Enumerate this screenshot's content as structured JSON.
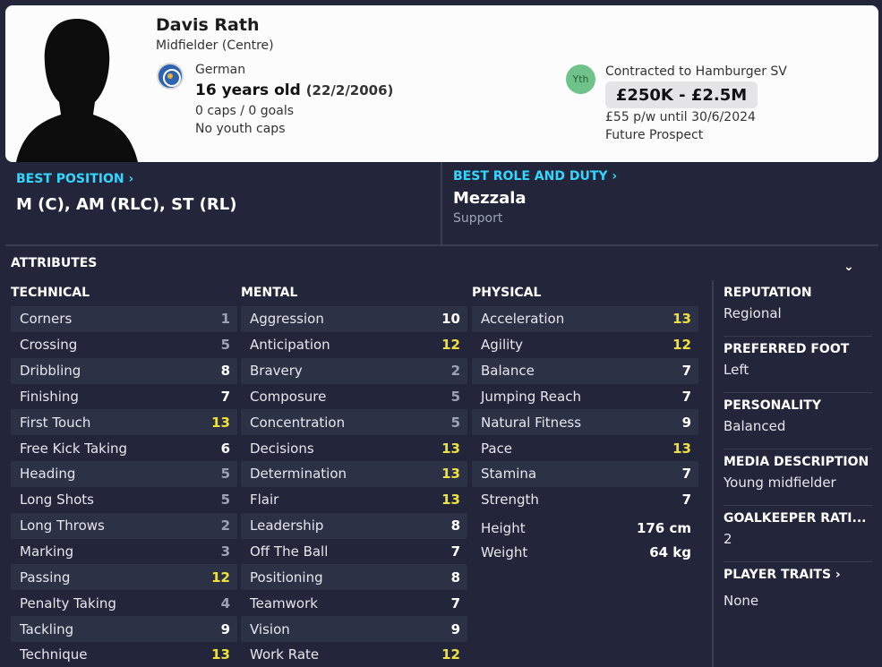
{
  "player": {
    "name": "Davis Rath",
    "position": "Midfielder (Centre)",
    "nationality": "German",
    "age": "16 years old",
    "dob": "(22/2/2006)",
    "caps": "0 caps / 0 goals",
    "youth_caps": "No youth caps"
  },
  "contract": {
    "badge": "Yth",
    "club": "Contracted to Hamburger SV",
    "value": "£250K - £2.5M",
    "wage": "£55 p/w until 30/6/2024",
    "status": "Future Prospect"
  },
  "best_position": {
    "label": "BEST POSITION",
    "value": "M (C), AM (RLC), ST (RL)"
  },
  "best_role": {
    "label": "BEST ROLE AND DUTY",
    "role": "Mezzala",
    "duty": "Support"
  },
  "attributes_title": "ATTRIBUTES",
  "columns": {
    "technical": {
      "title": "TECHNICAL",
      "rows": [
        {
          "name": "Corners",
          "value": "1"
        },
        {
          "name": "Crossing",
          "value": "5"
        },
        {
          "name": "Dribbling",
          "value": "8"
        },
        {
          "name": "Finishing",
          "value": "7"
        },
        {
          "name": "First Touch",
          "value": "13"
        },
        {
          "name": "Free Kick Taking",
          "value": "6"
        },
        {
          "name": "Heading",
          "value": "5"
        },
        {
          "name": "Long Shots",
          "value": "5"
        },
        {
          "name": "Long Throws",
          "value": "2"
        },
        {
          "name": "Marking",
          "value": "3"
        },
        {
          "name": "Passing",
          "value": "12"
        },
        {
          "name": "Penalty Taking",
          "value": "4"
        },
        {
          "name": "Tackling",
          "value": "9"
        },
        {
          "name": "Technique",
          "value": "13"
        }
      ]
    },
    "mental": {
      "title": "MENTAL",
      "rows": [
        {
          "name": "Aggression",
          "value": "10"
        },
        {
          "name": "Anticipation",
          "value": "12"
        },
        {
          "name": "Bravery",
          "value": "2"
        },
        {
          "name": "Composure",
          "value": "5"
        },
        {
          "name": "Concentration",
          "value": "5"
        },
        {
          "name": "Decisions",
          "value": "13"
        },
        {
          "name": "Determination",
          "value": "13"
        },
        {
          "name": "Flair",
          "value": "13"
        },
        {
          "name": "Leadership",
          "value": "8"
        },
        {
          "name": "Off The Ball",
          "value": "7"
        },
        {
          "name": "Positioning",
          "value": "8"
        },
        {
          "name": "Teamwork",
          "value": "7"
        },
        {
          "name": "Vision",
          "value": "9"
        },
        {
          "name": "Work Rate",
          "value": "12"
        }
      ]
    },
    "physical": {
      "title": "PHYSICAL",
      "rows": [
        {
          "name": "Acceleration",
          "value": "13"
        },
        {
          "name": "Agility",
          "value": "12"
        },
        {
          "name": "Balance",
          "value": "7"
        },
        {
          "name": "Jumping Reach",
          "value": "7"
        },
        {
          "name": "Natural Fitness",
          "value": "9"
        },
        {
          "name": "Pace",
          "value": "13"
        },
        {
          "name": "Stamina",
          "value": "7"
        },
        {
          "name": "Strength",
          "value": "7"
        }
      ],
      "height_label": "Height",
      "height": "176 cm",
      "weight_label": "Weight",
      "weight": "64 kg"
    }
  },
  "side": [
    {
      "heading": "REPUTATION",
      "value": "Regional"
    },
    {
      "heading": "PREFERRED FOOT",
      "value": "Left"
    },
    {
      "heading": "PERSONALITY",
      "value": "Balanced"
    },
    {
      "heading": "MEDIA DESCRIPTION",
      "value": "Young midfielder"
    },
    {
      "heading": "GOALKEEPER RATI...",
      "value": "2"
    },
    {
      "heading": "PLAYER TRAITS",
      "value": "None"
    }
  ],
  "colors": {
    "accent": "#33d6ff",
    "high": "#f0e23a",
    "background": "#23263a"
  }
}
